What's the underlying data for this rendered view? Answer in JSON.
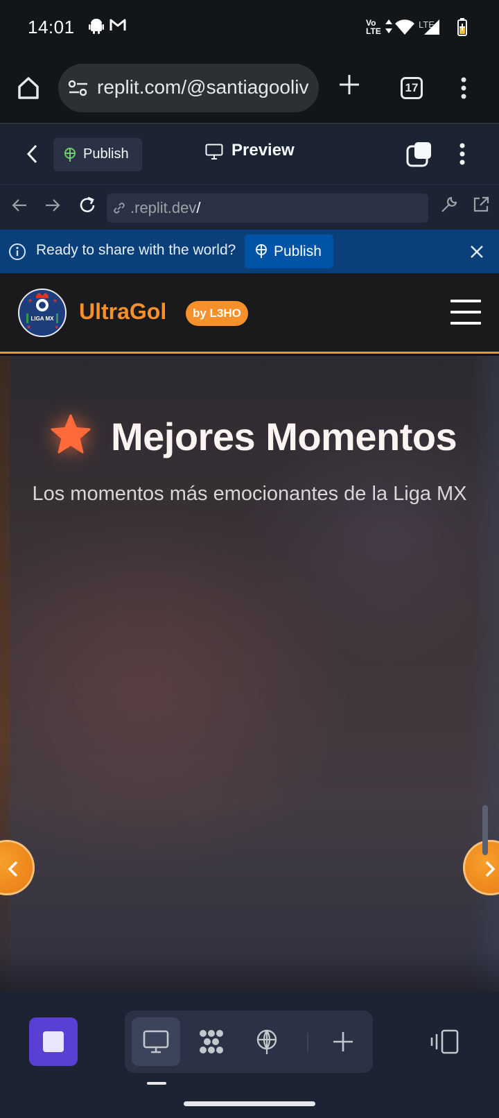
{
  "status_bar": {
    "time": "14:01",
    "volte_label": "Vo\nLTE",
    "lte_label": "LTE",
    "icons": [
      "android-icon",
      "gmail-icon",
      "wifi-icon",
      "signal-icon",
      "battery-icon"
    ]
  },
  "browser": {
    "url": "replit.com/@santiagooliv",
    "tab_count": "17"
  },
  "replit_header": {
    "publish_label": "Publish",
    "preview_label": "Preview"
  },
  "webview_nav": {
    "address_prefix": ".replit.dev",
    "address_suffix": "/"
  },
  "banner": {
    "message": "Ready to share with the world?",
    "publish_label": "Publish"
  },
  "site": {
    "logo_text": "LIGA MX",
    "brand": "UltraGol",
    "badge": "by L3HO"
  },
  "hero": {
    "title": "Mejores Momentos",
    "subtitle": "Los momentos más emocionantes de la Liga MX"
  },
  "colors": {
    "accent_orange": "#f5902a",
    "replit_bg": "#1c2333",
    "banner_blue": "#0b3f7a",
    "stop_purple": "#5a3fd4"
  }
}
